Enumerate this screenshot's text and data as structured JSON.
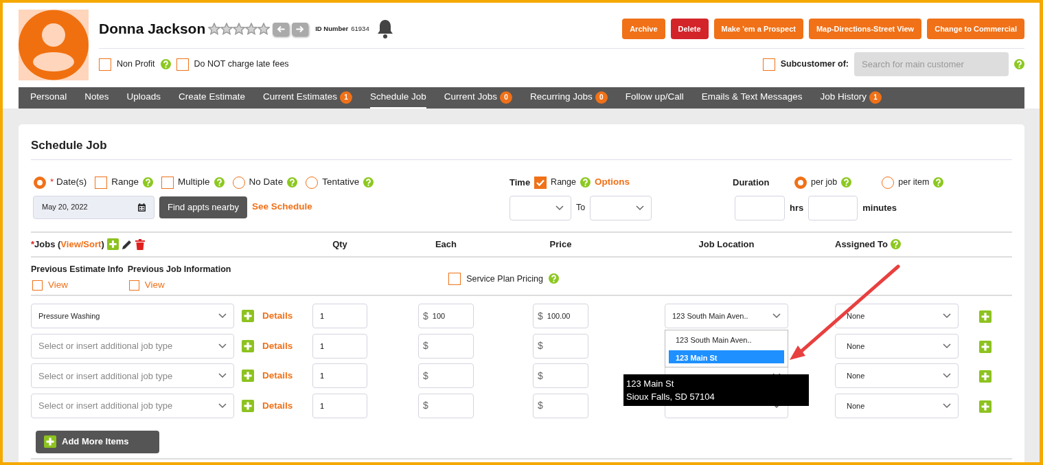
{
  "customer": {
    "name": "Donna Jackson",
    "stars": 0,
    "id_label": "ID Number",
    "id_value": "61934"
  },
  "actions": [
    {
      "label": "Archive",
      "kind": "primary"
    },
    {
      "label": "Delete",
      "kind": "danger"
    },
    {
      "label": "Make 'em a Prospect",
      "kind": "primary"
    },
    {
      "label": "Map-Directions-Street View",
      "kind": "primary"
    },
    {
      "label": "Change to Commercial",
      "kind": "primary"
    }
  ],
  "flags": [
    {
      "label": "Non Profit",
      "checked": false,
      "help": true
    },
    {
      "label": "Do NOT charge late fees",
      "checked": false,
      "help": false
    }
  ],
  "subcustomer": {
    "label": "Subcustomer of:",
    "checked": false,
    "placeholder": "Search for main customer",
    "help": true
  },
  "tabs": [
    {
      "label": "Personal",
      "selected": false
    },
    {
      "label": "Notes",
      "selected": false
    },
    {
      "label": "Uploads",
      "selected": false
    },
    {
      "label": "Create Estimate",
      "selected": false
    },
    {
      "label": "Current Estimates",
      "badge": "1",
      "selected": false
    },
    {
      "label": "Schedule Job",
      "selected": true
    },
    {
      "label": "Current Jobs",
      "badge": "0",
      "selected": false
    },
    {
      "label": "Recurring Jobs",
      "badge": "0",
      "selected": false
    },
    {
      "label": "Follow up/Call",
      "selected": false
    },
    {
      "label": "Emails & Text Messages",
      "selected": false
    },
    {
      "label": "Job History",
      "badge": "1",
      "selected": false
    }
  ],
  "section_title": "Schedule Job",
  "date_modes": [
    {
      "kind": "radio",
      "label": "Date(s)",
      "required_mark": "*",
      "selected": true,
      "help": false
    },
    {
      "kind": "checkbox",
      "label": "Range",
      "checked": false,
      "help": true
    },
    {
      "kind": "checkbox",
      "label": "Multiple",
      "checked": false,
      "help": true
    },
    {
      "kind": "radio",
      "label": "No Date",
      "selected": false,
      "help": true
    },
    {
      "kind": "radio",
      "label": "Tentative",
      "selected": false,
      "help": true
    }
  ],
  "date_value": "May 20, 2022",
  "find_button": "Find appts nearby",
  "schedule_link": "See Schedule",
  "time": {
    "label": "Time",
    "range_label": "Range",
    "range_checked": true,
    "options_link": "Options",
    "to_label": "To"
  },
  "duration": {
    "label": "Duration",
    "modes": [
      {
        "label": "per job",
        "selected": true
      },
      {
        "label": "per item",
        "selected": false
      }
    ],
    "hrs_label": "hrs",
    "minutes_label": "minutes"
  },
  "jobs_header": {
    "required_mark": "*",
    "prefix": "Jobs (",
    "link": "View/Sort",
    "suffix": ")"
  },
  "columns": [
    {
      "label": "Qty",
      "help": false
    },
    {
      "label": "Each",
      "help": false
    },
    {
      "label": "Price",
      "help": false
    },
    {
      "label": "Job Location",
      "help": false
    },
    {
      "label": "Assigned To",
      "help": true
    }
  ],
  "previous": [
    {
      "label": "Previous Estimate Info",
      "link": "View",
      "checked": false
    },
    {
      "label": "Previous Job Information",
      "link": "View",
      "checked": false
    }
  ],
  "service_plan": {
    "label": "Service Plan Pricing",
    "checked": false,
    "help": true
  },
  "rows": [
    {
      "job": "Pressure Washing",
      "details": "Details",
      "qty": "1",
      "each_currency": "$",
      "each": "100",
      "price_currency": "$",
      "price": "100.00",
      "location": "123 South Main Aven..",
      "assigned": "None"
    },
    {
      "job_placeholder": "Select or insert additional job type",
      "details": "Details",
      "qty": "1",
      "each_currency": "$",
      "price_currency": "$",
      "assigned": "None"
    },
    {
      "job_placeholder": "Select or insert additional job type",
      "details": "Details",
      "qty": "1",
      "each_currency": "$",
      "price_currency": "$",
      "has_location_field": true,
      "assigned": "None"
    },
    {
      "job_placeholder": "Select or insert additional job type",
      "details": "Details",
      "qty": "1",
      "each_currency": "$",
      "price_currency": "$",
      "has_location_field": true,
      "assigned": "None"
    }
  ],
  "add_more": "Add More Items",
  "location_dropdown": {
    "options": [
      {
        "label": "123 South Main Aven..",
        "selected": false
      },
      {
        "label": "123 Main St",
        "selected": true
      }
    ]
  },
  "tooltip": {
    "lines": [
      "123 Main St",
      "Sioux Falls, SD 57104"
    ]
  }
}
